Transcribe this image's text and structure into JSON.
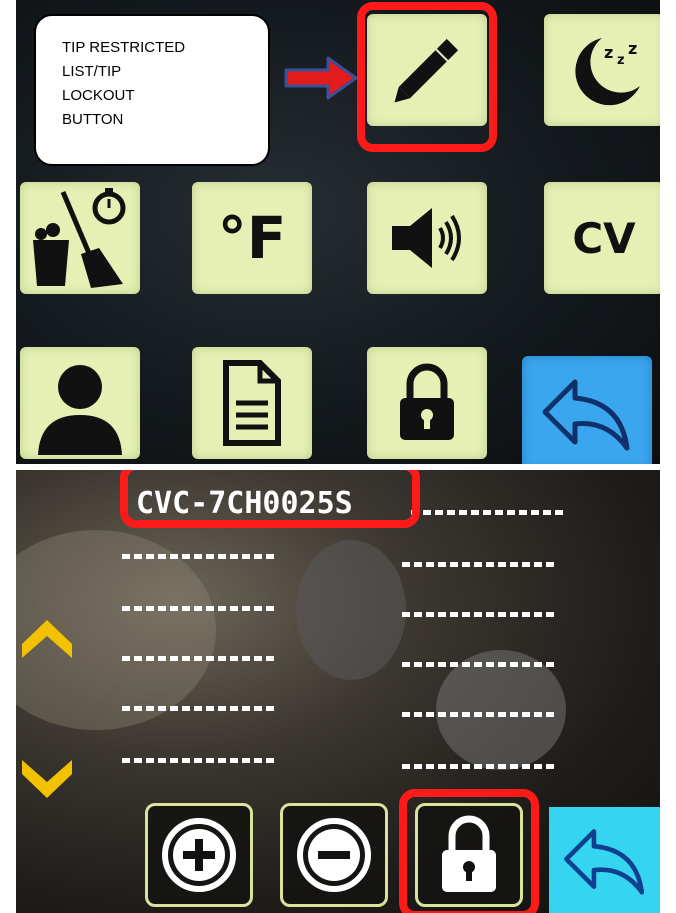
{
  "callout": {
    "text": "TIP RESTRICTED\nLIST/TIP\nLOCKOUT\nBUTTON"
  },
  "top_screen": {
    "tiles": [
      {
        "id": "pencil",
        "icon": "pencil-icon"
      },
      {
        "id": "sleep",
        "icon": "moon-sleep-icon",
        "text": "zzz"
      },
      {
        "id": "cleaning",
        "icon": "clean-timer-icon"
      },
      {
        "id": "temperature",
        "icon": "temp-unit-icon",
        "text": "°F"
      },
      {
        "id": "volume",
        "icon": "speaker-icon"
      },
      {
        "id": "cv",
        "icon": "cv-text-icon",
        "text": "CV"
      },
      {
        "id": "user",
        "icon": "user-icon"
      },
      {
        "id": "document",
        "icon": "document-icon"
      },
      {
        "id": "lock",
        "icon": "lock-icon"
      },
      {
        "id": "back",
        "icon": "back-arrow-icon"
      }
    ]
  },
  "bottom_screen": {
    "model_name": "CVC-7CH0025S",
    "list_rows": 5,
    "buttons": [
      {
        "id": "add",
        "icon": "plus-circle-icon"
      },
      {
        "id": "remove",
        "icon": "minus-circle-icon"
      },
      {
        "id": "lock",
        "icon": "lock-icon"
      },
      {
        "id": "back",
        "icon": "back-arrow-icon"
      }
    ],
    "scroll": {
      "up": "chevron-up-icon",
      "down": "chevron-down-icon"
    }
  },
  "colors": {
    "tile": "#e6f0b5",
    "tile_blue": "#3aa6ee",
    "highlight": "#ff1a1a",
    "chevron": "#f2c200",
    "cyan_button": "#35d5f2"
  }
}
